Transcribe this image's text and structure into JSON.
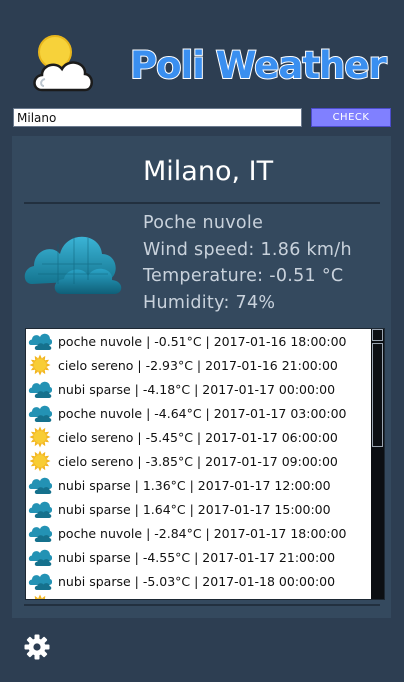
{
  "app": {
    "title": "Poli Weather",
    "logo_icon": "sun-cloud-icon"
  },
  "search": {
    "value": "Milano",
    "button_label": "CHECK"
  },
  "current": {
    "city": "Milano, IT",
    "icon": "broken-clouds-icon",
    "description": "Poche nuvole",
    "wind": "Wind speed: 1.86 km/h",
    "temperature": "Temperature: -0.51 °C",
    "humidity": "Humidity: 74%"
  },
  "forecast": [
    {
      "icon": "cloud-icon",
      "text": "poche nuvole | -0.51°C | 2017-01-16 18:00:00"
    },
    {
      "icon": "sun-icon",
      "text": "cielo sereno | -2.93°C | 2017-01-16 21:00:00"
    },
    {
      "icon": "cloud-icon",
      "text": "nubi sparse | -4.18°C | 2017-01-17 00:00:00"
    },
    {
      "icon": "cloud-icon",
      "text": "poche nuvole | -4.64°C | 2017-01-17 03:00:00"
    },
    {
      "icon": "sun-icon",
      "text": "cielo sereno | -5.45°C | 2017-01-17 06:00:00"
    },
    {
      "icon": "sun-icon",
      "text": "cielo sereno | -3.85°C | 2017-01-17 09:00:00"
    },
    {
      "icon": "cloud-icon",
      "text": "nubi sparse | 1.36°C | 2017-01-17 12:00:00"
    },
    {
      "icon": "cloud-icon",
      "text": "nubi sparse | 1.64°C | 2017-01-17 15:00:00"
    },
    {
      "icon": "cloud-icon",
      "text": "poche nuvole | -2.84°C | 2017-01-17 18:00:00"
    },
    {
      "icon": "cloud-icon",
      "text": "nubi sparse | -4.55°C | 2017-01-17 21:00:00"
    },
    {
      "icon": "cloud-icon",
      "text": "nubi sparse | -5.03°C | 2017-01-18 00:00:00"
    },
    {
      "icon": "sun-icon",
      "text": ""
    }
  ],
  "settings_icon": "gear-icon",
  "colors": {
    "background": "#2d3e52",
    "panel": "#34495e",
    "accent": "#8080ff",
    "title_blue": "#3a8ff0"
  }
}
